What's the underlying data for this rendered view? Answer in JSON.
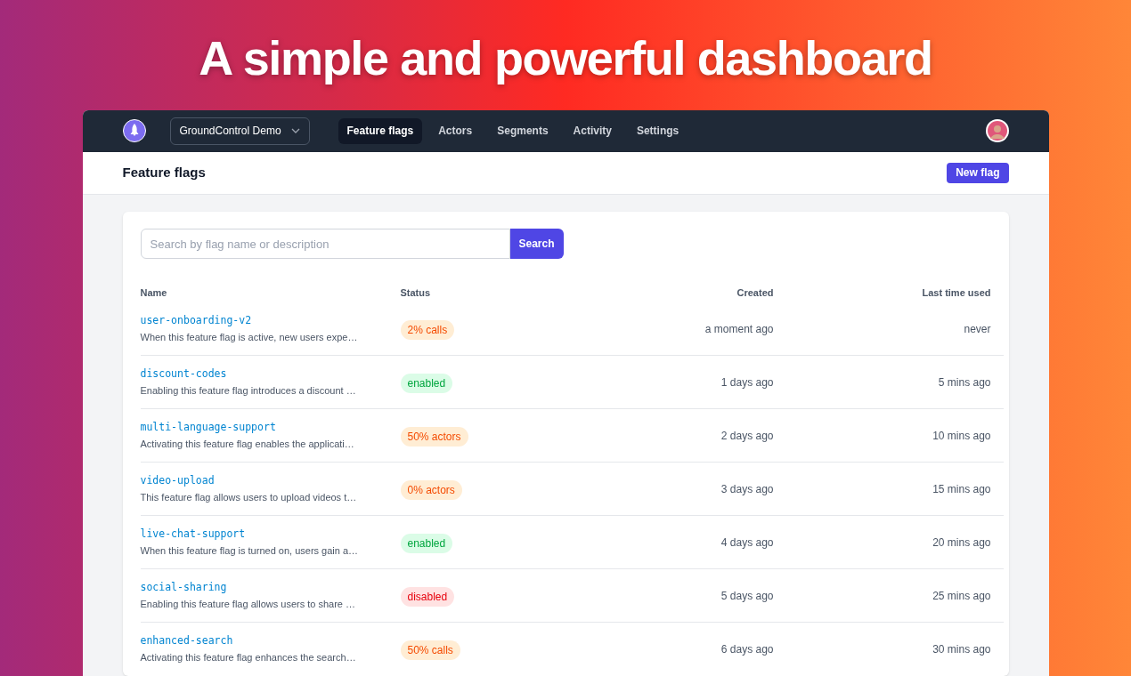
{
  "headline": "A simple and powerful dashboard",
  "nav": {
    "project": "GroundControl Demo",
    "tabs": [
      {
        "label": "Feature flags",
        "selected": true
      },
      {
        "label": "Actors",
        "selected": false
      },
      {
        "label": "Segments",
        "selected": false
      },
      {
        "label": "Activity",
        "selected": false
      },
      {
        "label": "Settings",
        "selected": false
      }
    ]
  },
  "page_title": "Feature flags",
  "new_button": "New flag",
  "search": {
    "placeholder": "Search by flag name or description",
    "button": "Search"
  },
  "table": {
    "columns": [
      "Name",
      "Status",
      "Created",
      "Last time used"
    ],
    "rows": [
      {
        "name": "user-onboarding-v2",
        "description": "When this feature flag is active, new users expe…",
        "status": "2% calls",
        "kind": "partial",
        "created": "a moment ago",
        "last_used": "never"
      },
      {
        "name": "discount-codes",
        "description": "Enabling this feature flag introduces a discount …",
        "status": "enabled",
        "kind": "enabled",
        "created": "1 days ago",
        "last_used": "5 mins ago"
      },
      {
        "name": "multi-language-support",
        "description": "Activating this feature flag enables the applicati…",
        "status": "50% actors",
        "kind": "partial",
        "created": "2 days ago",
        "last_used": "10 mins ago"
      },
      {
        "name": "video-upload",
        "description": "This feature flag allows users to upload videos t…",
        "status": "0% actors",
        "kind": "partial",
        "created": "3 days ago",
        "last_used": "15 mins ago"
      },
      {
        "name": "live-chat-support",
        "description": "When this feature flag is turned on, users gain a…",
        "status": "enabled",
        "kind": "enabled",
        "created": "4 days ago",
        "last_used": "20 mins ago"
      },
      {
        "name": "social-sharing",
        "description": "Enabling this feature flag allows users to share …",
        "status": "disabled",
        "kind": "disabled",
        "created": "5 days ago",
        "last_used": "25 mins ago"
      },
      {
        "name": "enhanced-search",
        "description": "Activating this feature flag enhances the search…",
        "status": "50% calls",
        "kind": "partial",
        "created": "6 days ago",
        "last_used": "30 mins ago"
      }
    ]
  }
}
